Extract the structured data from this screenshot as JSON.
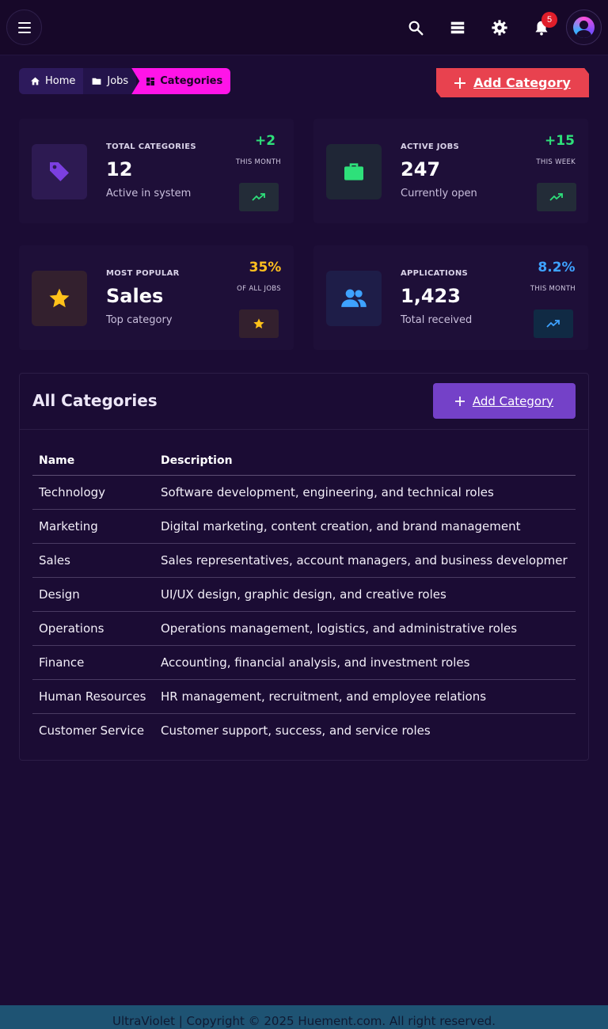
{
  "header": {
    "notification_count": "5"
  },
  "breadcrumb": {
    "items": [
      "Home",
      "Jobs",
      "Categories"
    ]
  },
  "actions": {
    "add_category_top": "Add Category",
    "add_category_card": "Add Category"
  },
  "stats": [
    {
      "label": "TOTAL CATEGORIES",
      "value": "12",
      "sub": "Active in system",
      "change": "+2",
      "period": "THIS MONTH",
      "accent": "#2ee07a",
      "icon": "tag-icon"
    },
    {
      "label": "ACTIVE JOBS",
      "value": "247",
      "sub": "Currently open",
      "change": "+15",
      "period": "THIS WEEK",
      "accent": "#2ee07a",
      "icon": "briefcase-icon"
    },
    {
      "label": "MOST POPULAR",
      "value": "Sales",
      "sub": "Top category",
      "change": "35%",
      "period": "OF ALL JOBS",
      "accent": "#ffbf1f",
      "icon": "star-icon"
    },
    {
      "label": "APPLICATIONS",
      "value": "1,423",
      "sub": "Total received",
      "change": "8.2%",
      "period": "THIS MONTH",
      "accent": "#3ea2ff",
      "icon": "users-icon"
    }
  ],
  "categories": {
    "title": "All Categories",
    "columns": [
      "Name",
      "Description"
    ],
    "rows": [
      {
        "name": "Technology",
        "description": "Software development, engineering, and technical roles"
      },
      {
        "name": "Marketing",
        "description": "Digital marketing, content creation, and brand management"
      },
      {
        "name": "Sales",
        "description": "Sales representatives, account managers, and business developmer"
      },
      {
        "name": "Design",
        "description": "UI/UX design, graphic design, and creative roles"
      },
      {
        "name": "Operations",
        "description": "Operations management, logistics, and administrative roles"
      },
      {
        "name": "Finance",
        "description": "Accounting, financial analysis, and investment roles"
      },
      {
        "name": "Human Resources",
        "description": "HR management, recruitment, and employee relations"
      },
      {
        "name": "Customer Service",
        "description": "Customer support, success, and service roles"
      }
    ]
  },
  "footer": {
    "text": "UltraViolet | Copyright © 2025 Huement.com. All right reserved."
  }
}
